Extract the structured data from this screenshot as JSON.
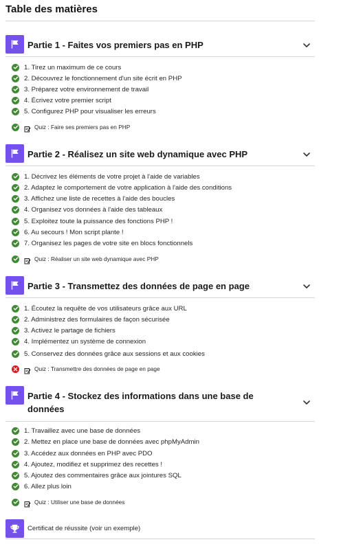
{
  "title": "Table des matières",
  "parts": [
    {
      "title": "Partie 1 - Faites vos premiers pas en PHP",
      "chapters": [
        "1. Tirez un maximum de ce cours",
        "2. Découvrez le fonctionnement d'un site écrit en PHP",
        "3. Préparez votre environnement de travail",
        "4. Écrivez votre premier script",
        "5. Configurez PHP pour visualiser les erreurs"
      ],
      "quiz": "Quiz : Faire ses premiers pas en PHP",
      "quiz_status": "passed"
    },
    {
      "title": "Partie 2 - Réalisez un site web dynamique avec PHP",
      "chapters": [
        "1. Décrivez les éléments de votre projet à l'aide de variables",
        "2. Adaptez le comportement de votre application à l'aide des conditions",
        "3. Affichez une liste de recettes à l'aide des boucles",
        "4. Organisez vos données à l'aide des tableaux",
        "5. Exploitez toute la puissance des fonctions PHP !",
        "6. Au secours ! Mon script plante !",
        "7. Organisez les pages de votre site en blocs fonctionnels"
      ],
      "quiz": "Quiz : Réaliser un site web dynamique avec PHP",
      "quiz_status": "passed"
    },
    {
      "title": "Partie 3 - Transmettez des données de page en page",
      "chapters": [
        "1. Écoutez la requête de vos utilisateurs grâce aux URL",
        "2. Administrez des formulaires de façon sécurisée",
        "3. Activez le partage de fichiers",
        "4. Implémentez un système de connexion",
        "5. Conservez des données grâce aux sessions et aux cookies"
      ],
      "quiz": "Quiz : Transmettre des données de page en page",
      "quiz_status": "failed"
    },
    {
      "title": "Partie 4 - Stockez des informations dans une base de données",
      "chapters": [
        "1. Travaillez avec une base de données",
        "2. Mettez en place une base de données avec phpMyAdmin",
        "3. Accédez aux données en PHP avec PDO",
        "4. Ajoutez, modifiez et supprimez des recettes !",
        "5. Ajoutez des commentaires grâce aux jointures SQL",
        "6. Allez plus loin"
      ],
      "quiz": "Quiz : Utiliser une base de données",
      "quiz_status": "passed"
    }
  ],
  "certificate": "Certificat de réussite (voir un exemple)",
  "colors": {
    "accent": "#7451eb",
    "done": "#3f8a32",
    "failed": "#d61d1d"
  },
  "icons": {
    "part": "flag-icon",
    "toggle": "chevron-down-icon",
    "done": "check-circle-icon",
    "failed": "cross-circle-icon",
    "quiz": "quiz-icon",
    "certificate": "trophy-icon"
  }
}
